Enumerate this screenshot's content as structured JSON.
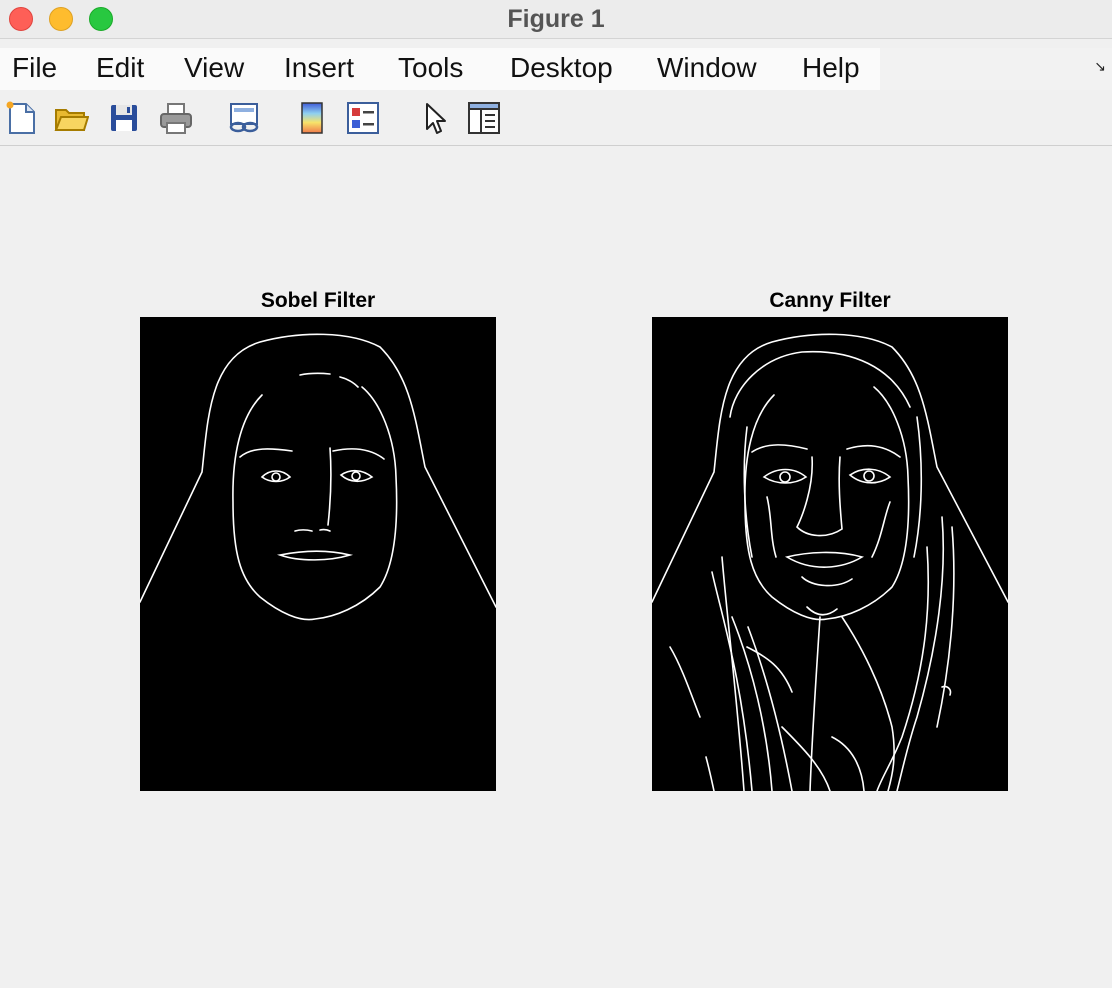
{
  "window": {
    "title": "Figure 1"
  },
  "menu": {
    "items": [
      "File",
      "Edit",
      "View",
      "Insert",
      "Tools",
      "Desktop",
      "Window",
      "Help"
    ]
  },
  "toolbar": {
    "icons": [
      "new-figure-icon",
      "open-folder-icon",
      "save-icon",
      "print-icon",
      "link-plot-icon",
      "colorbar-icon",
      "legend-icon",
      "pointer-arrow-icon",
      "property-inspector-icon"
    ]
  },
  "axes": [
    {
      "title": "Sobel Filter"
    },
    {
      "title": "Canny Filter"
    }
  ]
}
